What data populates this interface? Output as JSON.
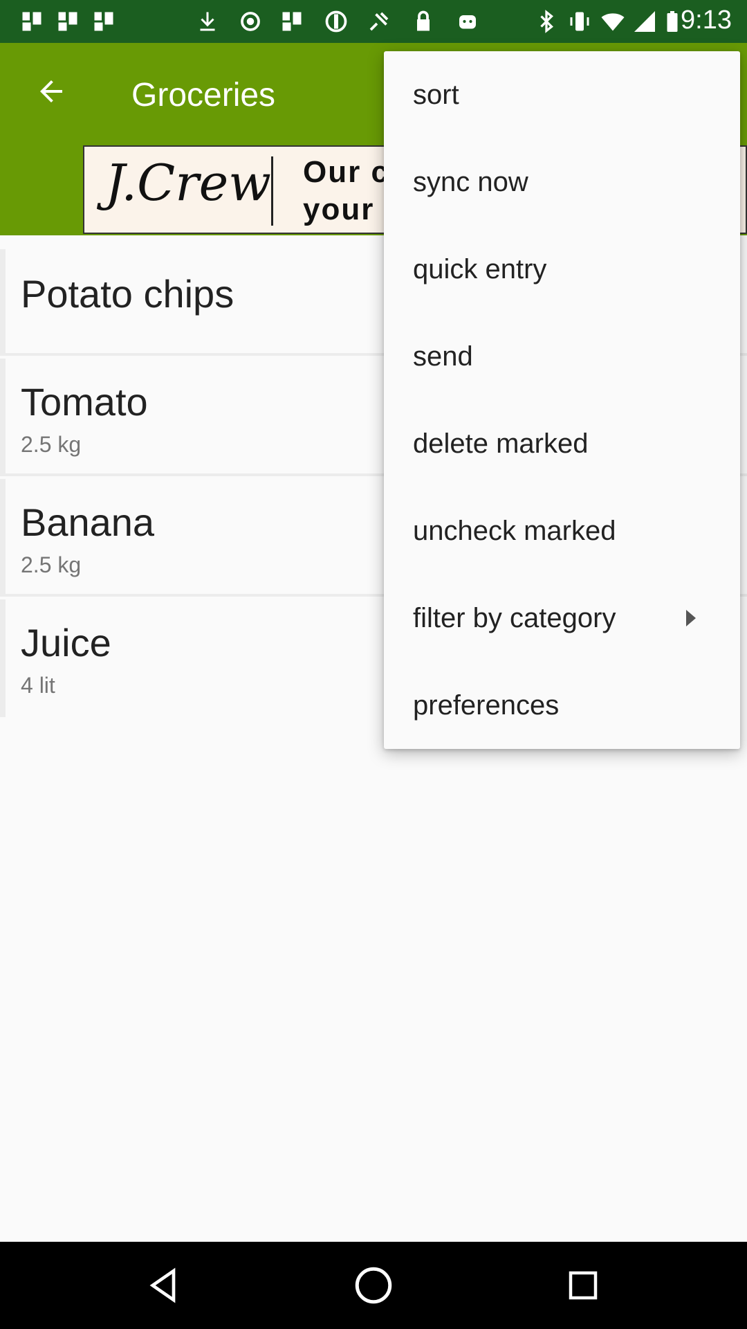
{
  "status_bar": {
    "time": "9:13",
    "left_icons": [
      "app-icon",
      "app-icon",
      "app-icon",
      "download-icon",
      "record-icon",
      "app-icon",
      "blocked-icon",
      "fake-gps-icon",
      "lock-icon",
      "android-icon"
    ],
    "right_icons": [
      "bluetooth-icon",
      "vibrate-icon",
      "wifi-icon",
      "signal-icon",
      "battery-icon"
    ]
  },
  "app_bar": {
    "title": "Groceries",
    "back_icon": "arrow-back-icon",
    "color": "#689a05"
  },
  "ad": {
    "logo": "J.Crew",
    "line1": "Our c",
    "line2": "your"
  },
  "list": {
    "items": [
      {
        "name": "Potato chips",
        "quantity": ""
      },
      {
        "name": "Tomato",
        "quantity": "2.5 kg"
      },
      {
        "name": "Banana",
        "quantity": "2.5 kg"
      },
      {
        "name": "Juice",
        "quantity": "4 lit"
      }
    ]
  },
  "menu": {
    "items": [
      {
        "label": "sort"
      },
      {
        "label": "sync now"
      },
      {
        "label": "quick entry"
      },
      {
        "label": "send"
      },
      {
        "label": "delete marked"
      },
      {
        "label": "uncheck marked"
      },
      {
        "label": "filter by category",
        "has_submenu": true
      },
      {
        "label": "preferences"
      }
    ]
  },
  "nav_bar": {
    "buttons": [
      "back-triangle-icon",
      "home-circle-icon",
      "recents-square-icon"
    ]
  }
}
